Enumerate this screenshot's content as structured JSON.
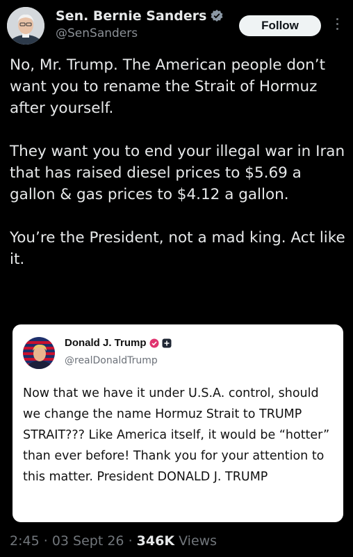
{
  "tweet": {
    "display_name": "Sen. Bernie Sanders",
    "handle": "@SenSanders",
    "follow_label": "Follow",
    "paragraphs": [
      "No, Mr. Trump. The American people don’t want you to rename the Strait of Hormuz after yourself.",
      "They want you to end your illegal war in Iran that has raised diesel prices to $5.69 a gallon & gas prices to $4.12 a gallon.",
      "You’re the President, not a mad king. Act like it."
    ]
  },
  "quoted": {
    "display_name": "Donald J. Trump",
    "handle": "@realDonaldTrump",
    "text": "Now that we have it under U.S.A. control, should we change the name Hormuz Strait to TRUMP STRAIT??? Like America itself, it would be “hotter” than ever before! Thank you for your attention to this matter. President DONALD J. TRUMP"
  },
  "meta": {
    "time": "2:45",
    "date": "03 Sept 26",
    "views_count": "346K",
    "views_label": "Views"
  },
  "colors": {
    "background": "#000000",
    "verified_gray": "#8b98a5",
    "truth_badge": "#e0336f"
  },
  "icons": {
    "verified": "verified-badge-icon",
    "more": "more-vertical-icon"
  }
}
